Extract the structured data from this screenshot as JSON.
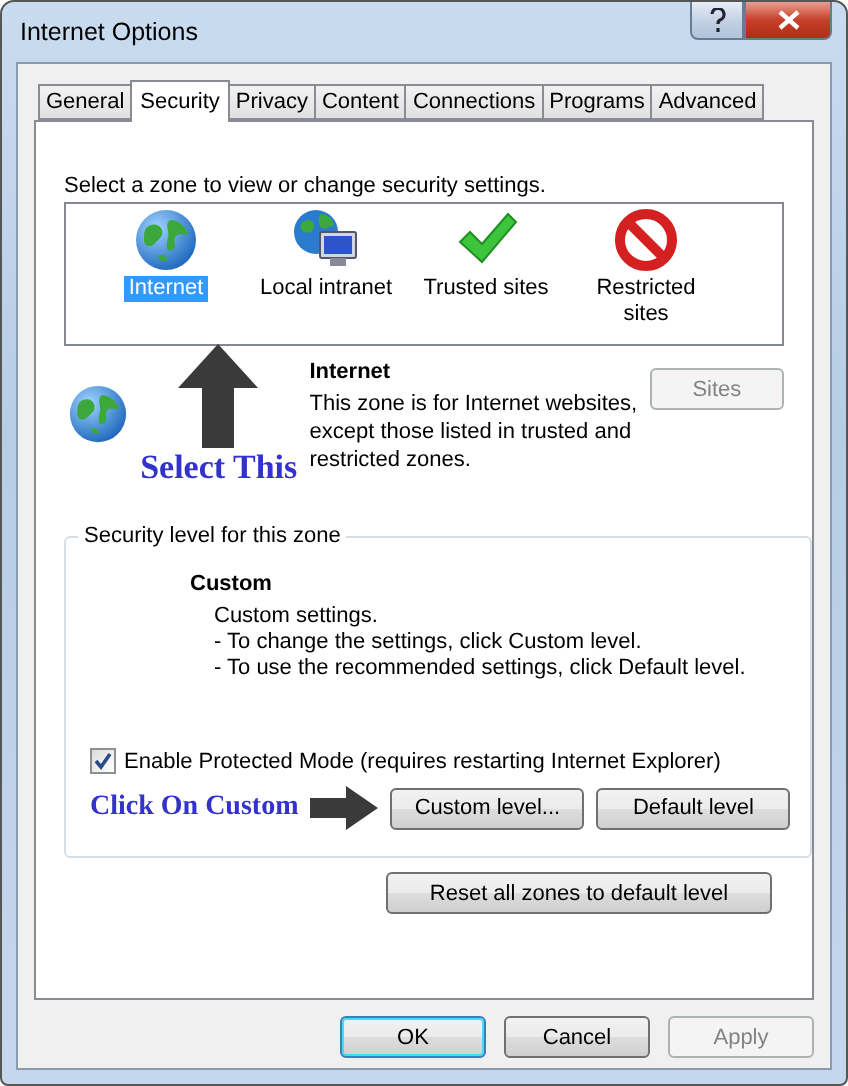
{
  "window": {
    "title": "Internet Options"
  },
  "tabs": [
    {
      "label": "General",
      "selected": false
    },
    {
      "label": "Security",
      "selected": true
    },
    {
      "label": "Privacy",
      "selected": false
    },
    {
      "label": "Content",
      "selected": false
    },
    {
      "label": "Connections",
      "selected": false
    },
    {
      "label": "Programs",
      "selected": false
    },
    {
      "label": "Advanced",
      "selected": false
    }
  ],
  "prompt": "Select a zone to view or change security settings.",
  "zones": [
    {
      "label": "Internet",
      "kind": "globe",
      "selected": true
    },
    {
      "label": "Local intranet",
      "kind": "intranet",
      "selected": false
    },
    {
      "label": "Trusted sites",
      "kind": "check",
      "selected": false
    },
    {
      "label": "Restricted sites",
      "kind": "restricted",
      "selected": false
    }
  ],
  "zone_info": {
    "title": "Internet",
    "description": "This zone is for Internet websites, except those listed in trusted and restricted zones."
  },
  "sites_button": {
    "label": "Sites",
    "disabled": true
  },
  "security_level": {
    "legend": "Security level for this zone",
    "level_name": "Custom",
    "lines": [
      "Custom settings.",
      "- To change the settings, click Custom level.",
      "- To use the recommended settings, click Default level."
    ]
  },
  "protected_mode": {
    "label": "Enable Protected Mode (requires restarting Internet Explorer)",
    "checked": true
  },
  "level_buttons": [
    "Custom level...",
    "Default level"
  ],
  "reset_button": "Reset all zones to default level",
  "footer_buttons": [
    {
      "label": "OK",
      "kind": "default",
      "disabled": false
    },
    {
      "label": "Cancel",
      "kind": "normal",
      "disabled": false
    },
    {
      "label": "Apply",
      "kind": "normal",
      "disabled": true
    }
  ],
  "annotations": [
    {
      "text": "Select This"
    },
    {
      "text": "Click On Custom"
    }
  ]
}
